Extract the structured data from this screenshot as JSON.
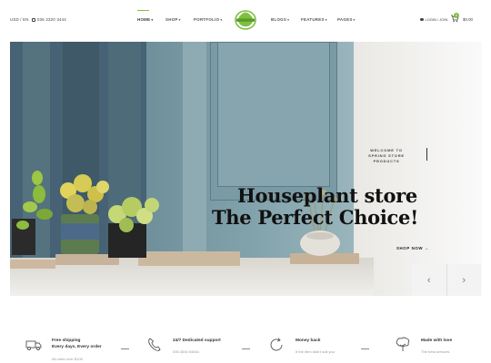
{
  "header": {
    "currency": "USD / EN",
    "phone": "036 2320 3444",
    "nav": [
      {
        "label": "HOME"
      },
      {
        "label": "SHOP"
      },
      {
        "label": "PORTFOLIO"
      },
      {
        "label": "BLOGS"
      },
      {
        "label": "FEATURES"
      },
      {
        "label": "PAGES"
      }
    ],
    "logo_text": "SPRING",
    "login": "LOGIN / JOIN",
    "cart_count": "0",
    "cart_total": "$0.00",
    "accent_color": "#7fbf3f"
  },
  "hero": {
    "welcome": "WELCOME TO SPRING STORE PRODUCTS",
    "headline_line1": "Houseplant store",
    "headline_line2": "The Perfect Choice!",
    "cta": "SHOP NOW →",
    "prev_icon": "‹",
    "next_icon": "›"
  },
  "features": [
    {
      "icon": "truck-icon",
      "title": "Free shipping",
      "title2": "Every days, Every order",
      "subtitle": "All order over $100"
    },
    {
      "icon": "phone-icon",
      "title": "24/7 Dedicated support",
      "subtitle": "035 4534 54664"
    },
    {
      "icon": "refresh-icon",
      "title": "Money back",
      "subtitle": "If the item didn't suit you"
    },
    {
      "icon": "tree-icon",
      "title": "Made with love",
      "subtitle": "The best services"
    }
  ]
}
